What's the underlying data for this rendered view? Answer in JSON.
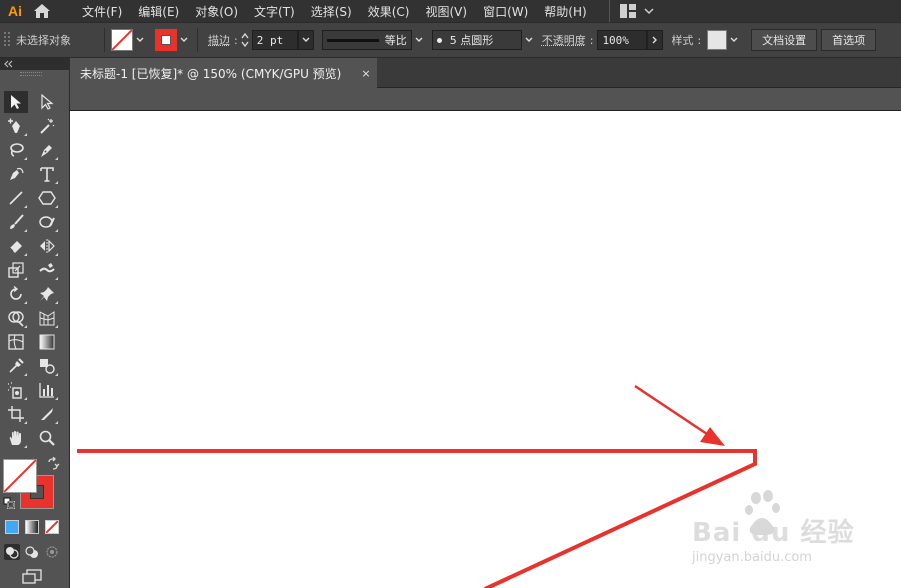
{
  "app": {
    "logo_text": "Ai"
  },
  "menu": {
    "items": [
      {
        "label": "文件(F)"
      },
      {
        "label": "编辑(E)"
      },
      {
        "label": "对象(O)"
      },
      {
        "label": "文字(T)"
      },
      {
        "label": "选择(S)"
      },
      {
        "label": "效果(C)"
      },
      {
        "label": "视图(V)"
      },
      {
        "label": "窗口(W)"
      },
      {
        "label": "帮助(H)"
      }
    ]
  },
  "control_bar": {
    "selection_status": "未选择对象",
    "stroke_label": "描边",
    "stroke_weight": "2 pt",
    "stroke_profile_label": "等比",
    "brush_label": "5 点圆形",
    "opacity_label": "不透明度",
    "opacity_value": "100%",
    "style_label": "样式",
    "doc_settings_button": "文档设置",
    "preferences_button": "首选项"
  },
  "tab": {
    "title": "未标题-1 [已恢复]* @ 150% (CMYK/GPU 预览)",
    "close_glyph": "×"
  },
  "colors": {
    "artwork_stroke": "#e8322b",
    "accent_orange": "#ff9a00",
    "ui_dark": "#323232",
    "ui_mid": "#535353"
  },
  "watermark": {
    "brand_text": "Bai du 经验",
    "url_text": "jingyan.baidu.com"
  }
}
